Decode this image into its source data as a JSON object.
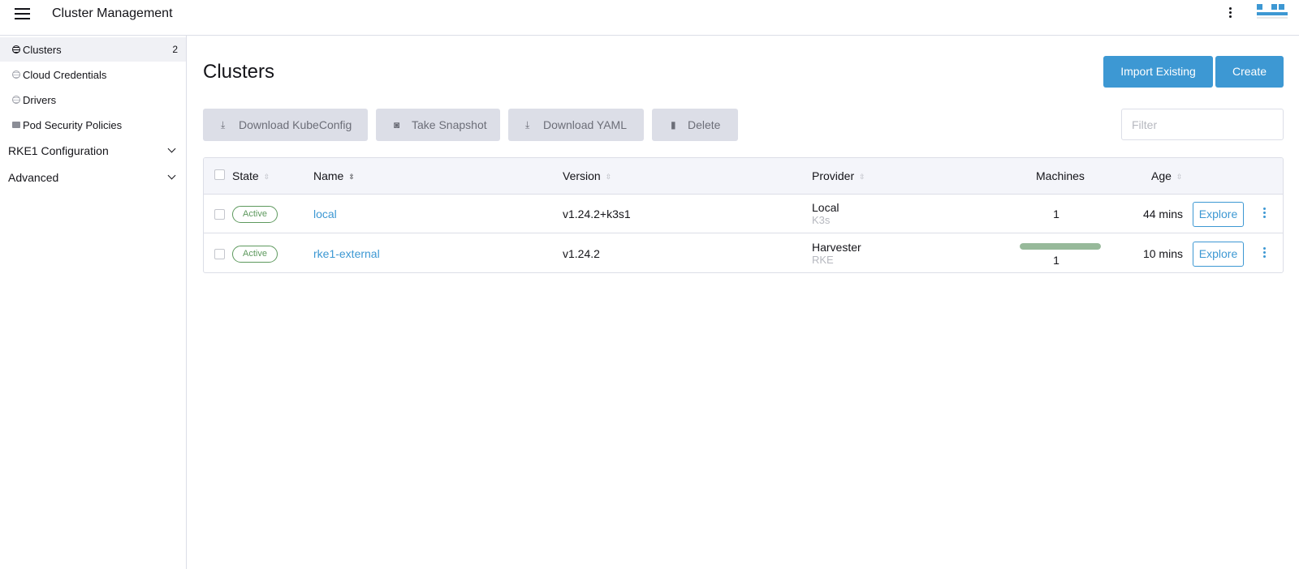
{
  "header": {
    "title": "Cluster Management",
    "menu_icon": "hamburger-icon",
    "more_icon": "kebab-icon",
    "logo": "rancher-logo"
  },
  "sidebar": {
    "items": [
      {
        "label": "Clusters",
        "count": "2",
        "icon": "globe-icon",
        "active": true
      },
      {
        "label": "Cloud Credentials",
        "icon": "globe-icon"
      },
      {
        "label": "Drivers",
        "icon": "globe-icon"
      },
      {
        "label": "Pod Security Policies",
        "icon": "folder-icon"
      }
    ],
    "groups": [
      {
        "label": "RKE1 Configuration",
        "icon": "chevron-down-icon"
      },
      {
        "label": "Advanced",
        "icon": "chevron-down-icon"
      }
    ]
  },
  "main": {
    "title": "Clusters",
    "import_label": "Import Existing",
    "create_label": "Create",
    "bulk_actions": [
      {
        "label": "Download KubeConfig",
        "icon": "download-icon"
      },
      {
        "label": "Take Snapshot",
        "icon": "camera-icon"
      },
      {
        "label": "Download YAML",
        "icon": "download-icon"
      },
      {
        "label": "Delete",
        "icon": "trash-icon"
      }
    ],
    "filter_placeholder": "Filter"
  },
  "table": {
    "columns": [
      "State",
      "Name",
      "Version",
      "Provider",
      "Machines",
      "Age"
    ],
    "rows": [
      {
        "state": "Active",
        "name": "local",
        "version": "v1.24.2+k3s1",
        "provider": "Local",
        "provider_sub": "K3s",
        "machines": "1",
        "age": "44 mins",
        "action": "Explore"
      },
      {
        "state": "Active",
        "name": "rke1-external",
        "version": "v1.24.2",
        "provider": "Harvester",
        "provider_sub": "RKE",
        "machines": "1",
        "machines_progress": 1.0,
        "age": "10 mins",
        "action": "Explore"
      }
    ]
  },
  "colors": {
    "accent": "#3d98d3",
    "active_state": "#5d995d",
    "progress_fill": "#97b99a"
  }
}
